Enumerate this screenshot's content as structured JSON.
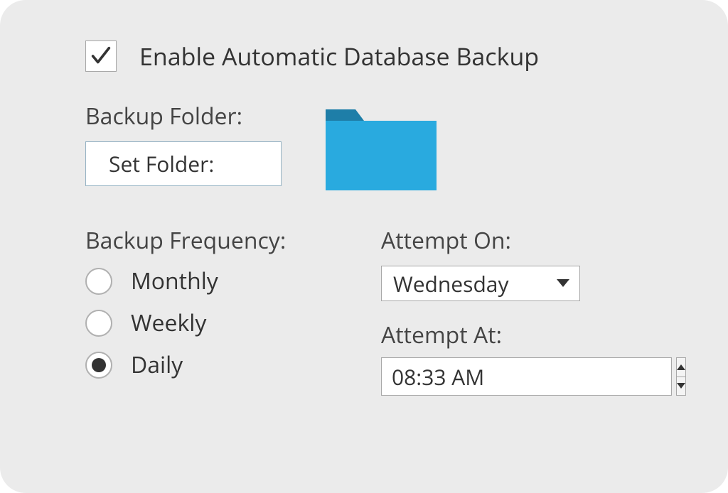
{
  "enableBackup": {
    "label": "Enable Automatic Database Backup",
    "checked": true
  },
  "backupFolder": {
    "label": "Backup Folder:",
    "buttonLabel": "Set Folder:"
  },
  "frequency": {
    "label": "Backup Frequency:",
    "options": [
      {
        "label": "Monthly",
        "selected": false
      },
      {
        "label": "Weekly",
        "selected": false
      },
      {
        "label": "Daily",
        "selected": true
      }
    ]
  },
  "attemptOn": {
    "label": "Attempt On:",
    "value": "Wednesday"
  },
  "attemptAt": {
    "label": "Attempt At:",
    "value": "08:33 AM"
  }
}
